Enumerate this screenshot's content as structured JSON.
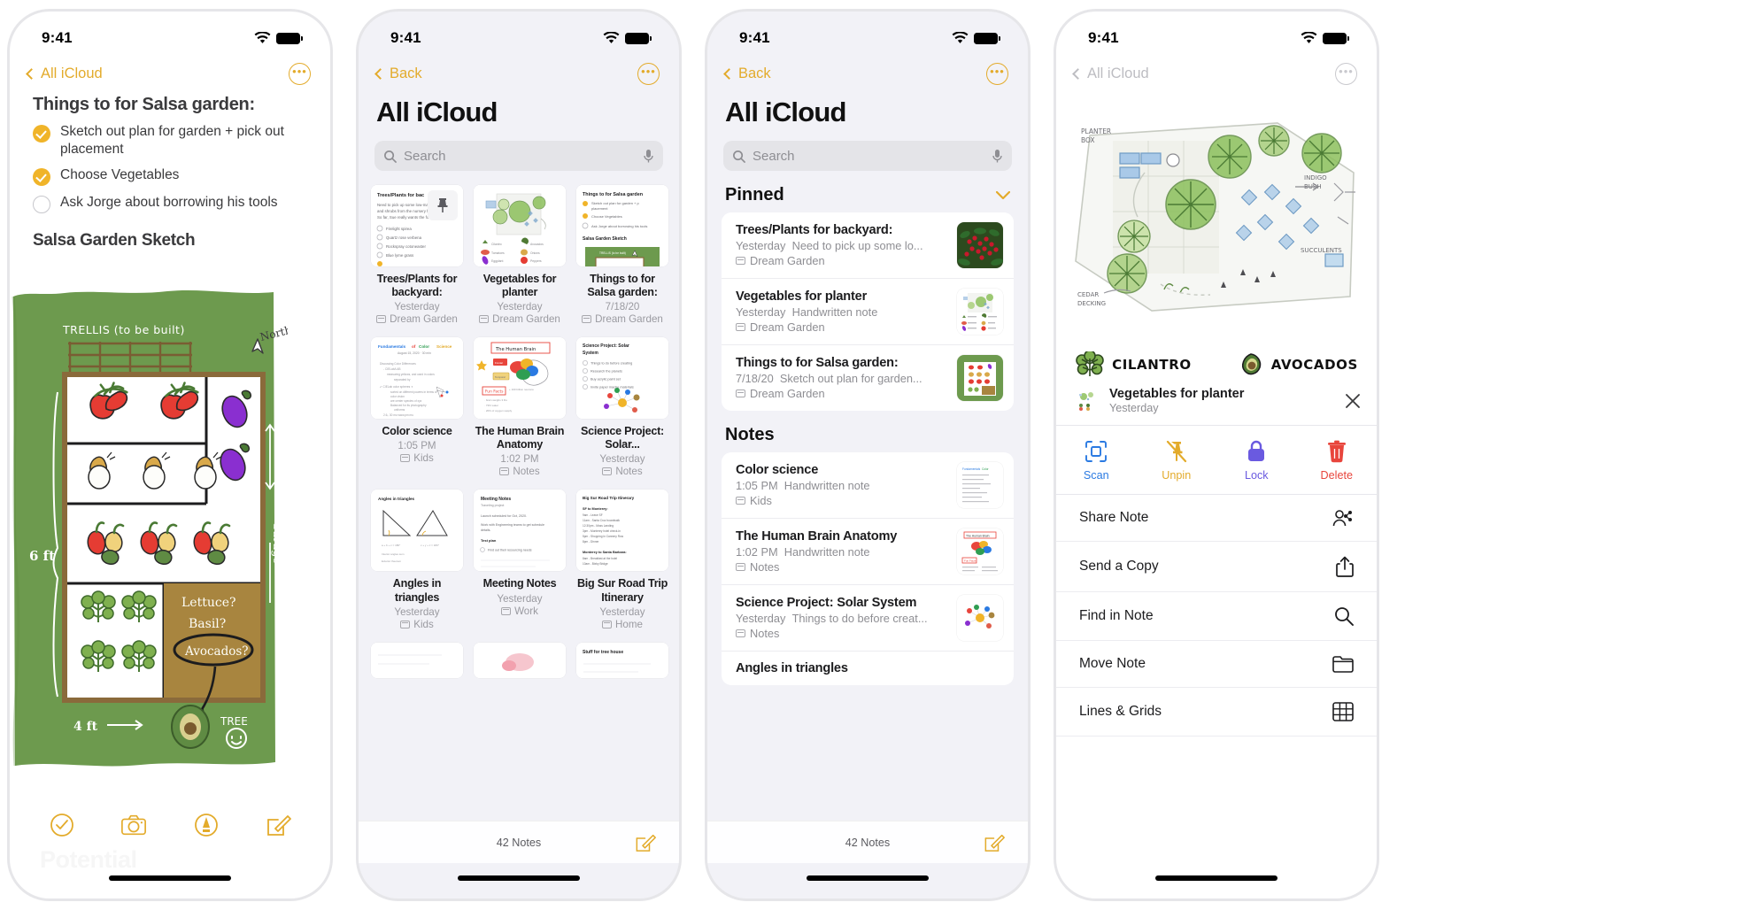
{
  "status": {
    "time": "9:41",
    "wifi_icon": "wifi-icon",
    "battery_icon": "battery-icon"
  },
  "phone1": {
    "nav": {
      "back_label": "All iCloud",
      "more_label": "•••"
    },
    "note_title": "Things to for Salsa garden:",
    "todos": [
      {
        "label": "Sketch out plan for garden + pick out placement",
        "checked": true
      },
      {
        "label": "Choose Vegetables",
        "checked": true
      },
      {
        "label": "Ask Jorge about borrowing his tools",
        "checked": false
      }
    ],
    "section_title": "Salsa Garden Sketch",
    "sketch": {
      "trellis_label": "TRELLIS (to be built)",
      "north_label": "North",
      "left_dim": "6 ft",
      "bottom_dim": "4 ft",
      "right_label": "Garage",
      "question_lines": [
        "Lettuce?",
        "Basil?",
        "Avocados?"
      ],
      "tree_label": "TREE"
    },
    "toolbar": [
      "checklist-icon",
      "camera-icon",
      "markup-icon",
      "compose-icon"
    ],
    "watermark": "Potential"
  },
  "phone2": {
    "nav": {
      "back_label": "Back"
    },
    "title": "All iCloud",
    "search": {
      "placeholder": "Search",
      "mic_icon": "microphone-icon"
    },
    "notes": [
      {
        "title": "Trees/Plants for backyard:",
        "date": "Yesterday",
        "folder": "Dream Garden",
        "thumb": "checklist",
        "pinned": true,
        "thumb_text": {
          "heading": "Trees/Plants for bac",
          "body": "Need to pick up some low-mainten and shrubs from the nursery for the front yard. So far, Sue really wants the following:",
          "items": [
            "Firelight spirea",
            "Quartz rose verbena",
            "Rockspray cotoneaster",
            "Blue lyme grass"
          ]
        }
      },
      {
        "title": "Vegetables for planter",
        "date": "Yesterday",
        "folder": "Dream Garden",
        "thumb": "garden-plan"
      },
      {
        "title": "Things to for Salsa garden:",
        "date": "7/18/20",
        "folder": "Dream Garden",
        "thumb": "salsa-garden"
      },
      {
        "title": "Color science",
        "date": "1:05 PM",
        "folder": "Kids",
        "thumb": "color-science",
        "thumb_text": {
          "heading": "Fundamentals of Color Science",
          "sub": "August 15, 2020  ·  30 min"
        }
      },
      {
        "title": "The Human Brain Anatomy",
        "date": "1:02 PM",
        "folder": "Notes",
        "thumb": "brain-diagram",
        "thumb_text": {
          "heading": "The Human Brain",
          "fun": "Fun Facts"
        }
      },
      {
        "title": "Science Project: Solar...",
        "date": "Yesterday",
        "folder": "Notes",
        "thumb": "solar-system",
        "thumb_text": {
          "heading": "Science Project: Solar System",
          "items": [
            "Things to do before creating",
            "Research the planets",
            "Buy acrylic paint set",
            "Invite paper mache materials"
          ]
        }
      },
      {
        "title": "Angles in triangles",
        "date": "Yesterday",
        "folder": "Kids",
        "thumb": "triangles",
        "thumb_text": {
          "heading": "Angles in triangles"
        }
      },
      {
        "title": "Meeting Notes",
        "date": "Yesterday",
        "folder": "Work",
        "thumb": "meeting-notes",
        "thumb_text": {
          "heading": "Meeting Notes",
          "sub": "Traveling project"
        }
      },
      {
        "title": "Big Sur Road Trip Itinerary",
        "date": "Yesterday",
        "folder": "Home",
        "thumb": "itinerary",
        "thumb_text": {
          "heading": "Big Sur Road Trip Itinerary"
        }
      },
      {
        "title": "",
        "date": "",
        "folder": "",
        "thumb": "blank-partial"
      },
      {
        "title": "",
        "date": "",
        "folder": "",
        "thumb": "pink-partial"
      },
      {
        "title": "",
        "date": "",
        "folder": "",
        "thumb": "treehouse-partial",
        "thumb_text": {
          "heading": "Stuff for tree house"
        }
      }
    ],
    "footer": {
      "count": "42 Notes",
      "compose_icon": "compose-icon"
    }
  },
  "phone3": {
    "nav": {
      "back_label": "Back"
    },
    "title": "All iCloud",
    "search": {
      "placeholder": "Search",
      "mic_icon": "microphone-icon"
    },
    "sections": [
      {
        "label": "Pinned",
        "collapse_icon": "chevron-down-icon",
        "rows": [
          {
            "title": "Trees/Plants for backyard:",
            "date": "Yesterday",
            "preview": "Need to pick up some lo...",
            "folder": "Dream Garden",
            "thumb": "berries-photo"
          },
          {
            "title": "Vegetables for planter",
            "date": "Yesterday",
            "preview": "Handwritten note",
            "folder": "Dream Garden",
            "thumb": "garden-plan"
          },
          {
            "title": "Things to for Salsa garden:",
            "date": "7/18/20",
            "preview": "Sketch out plan for garden...",
            "folder": "Dream Garden",
            "thumb": "salsa-garden"
          }
        ]
      },
      {
        "label": "Notes",
        "rows": [
          {
            "title": "Color science",
            "date": "1:05 PM",
            "preview": "Handwritten note",
            "folder": "Kids",
            "thumb": "color-science"
          },
          {
            "title": "The Human Brain Anatomy",
            "date": "1:02 PM",
            "preview": "Handwritten note",
            "folder": "Notes",
            "thumb": "brain-diagram"
          },
          {
            "title": "Science Project: Solar System",
            "date": "Yesterday",
            "preview": "Things to do before creat...",
            "folder": "Notes",
            "thumb": "solar-system"
          },
          {
            "title": "Angles in triangles",
            "date": "",
            "preview": "",
            "folder": "",
            "thumb": "triangles"
          }
        ]
      }
    ],
    "footer": {
      "count": "42 Notes",
      "compose_icon": "compose-icon"
    }
  },
  "phone4": {
    "nav": {
      "back_label": "All iCloud"
    },
    "plan": {
      "planter_box_label": "PLANTER BOX",
      "cedar_label": "CEDAR DECKING",
      "indigo_label": "INDIGO BUSH",
      "succulents_label": "SUCCULENTS"
    },
    "legend": [
      {
        "label": "CILANTRO",
        "icon": "cilantro-icon"
      },
      {
        "label": "AVOCADOS",
        "icon": "avocado-icon"
      }
    ],
    "selected_note": {
      "title": "Vegetables for planter",
      "date": "Yesterday",
      "close_icon": "close-icon",
      "thumb": "garden-plan"
    },
    "actions": [
      {
        "label": "Scan",
        "icon": "scan-icon",
        "color": "#2a7ae2"
      },
      {
        "label": "Unpin",
        "icon": "unpin-icon",
        "color": "#e3ab2b"
      },
      {
        "label": "Lock",
        "icon": "lock-icon",
        "color": "#6a5ae0"
      },
      {
        "label": "Delete",
        "icon": "trash-icon",
        "color": "#e8453c"
      }
    ],
    "menu": [
      {
        "label": "Share Note",
        "icon": "share-person-icon"
      },
      {
        "label": "Send a Copy",
        "icon": "share-up-icon"
      },
      {
        "label": "Find in Note",
        "icon": "search-icon"
      },
      {
        "label": "Move Note",
        "icon": "folder-icon"
      },
      {
        "label": "Lines & Grids",
        "icon": "grid-icon"
      }
    ]
  },
  "colors": {
    "accent": "#e3ab2b",
    "garden_green": "#6d9a4e",
    "red": "#e8453c",
    "blue": "#2a7ae2",
    "purple": "#6a5ae0"
  }
}
